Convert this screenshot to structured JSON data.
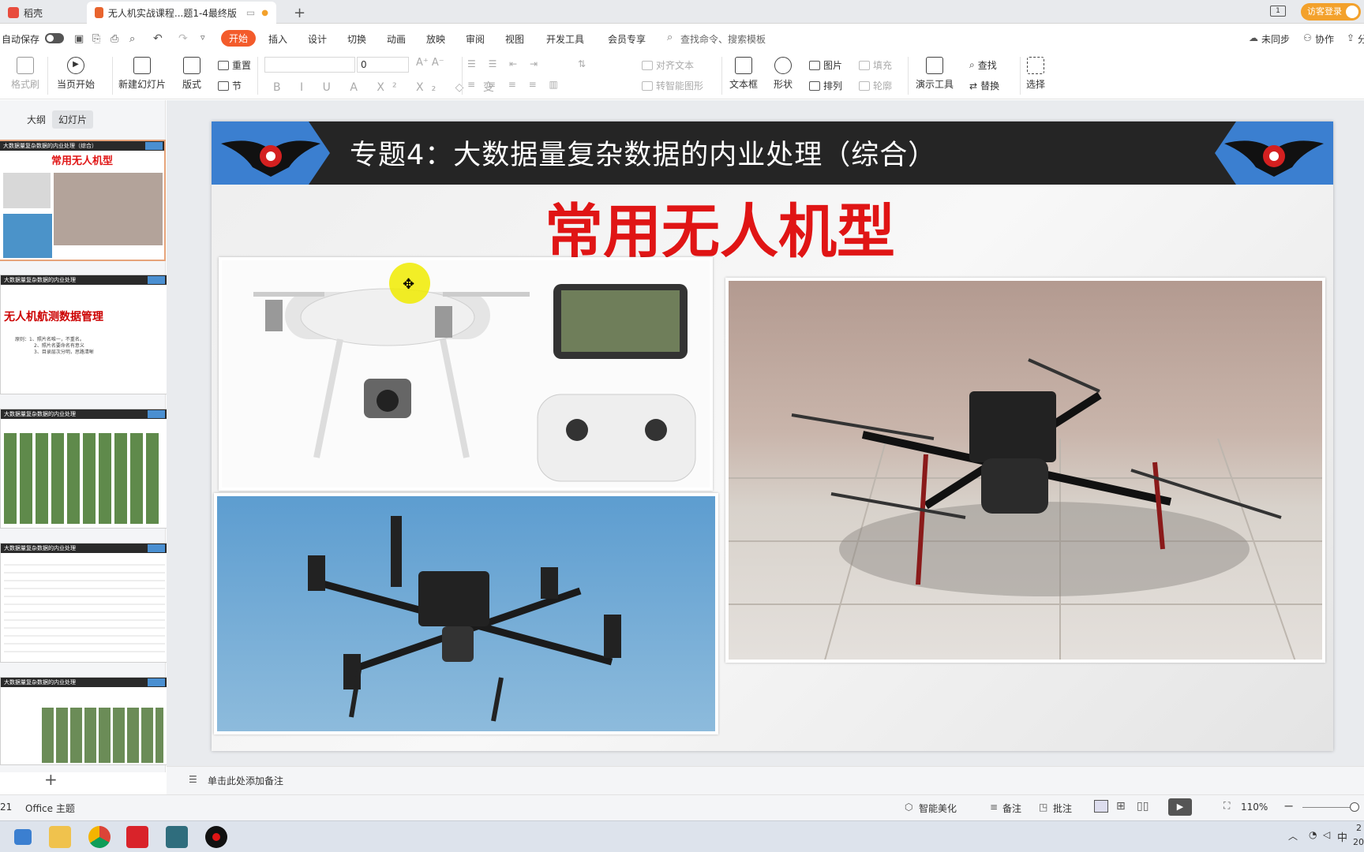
{
  "tabs": [
    {
      "label": "稻壳"
    },
    {
      "label": "无人机实战课程...题1-4最终版"
    }
  ],
  "titlebar": {
    "guest_login": "访客登录"
  },
  "menu": {
    "autosave": "自动保存",
    "items": [
      "开始",
      "插入",
      "设计",
      "切换",
      "动画",
      "放映",
      "审阅",
      "视图",
      "开发工具",
      "会员专享"
    ],
    "search": "查找命令、搜索模板",
    "unsync": "未同步",
    "collab": "协作",
    "share": "分"
  },
  "ribbon": {
    "format_painter": "格式刷",
    "from_current": "当页开始",
    "new_slide": "新建幻灯片",
    "layout": "版式",
    "reset": "重置",
    "section": "节",
    "font_size": "0",
    "align_text": "对齐文本",
    "to_smartart": "转智能图形",
    "textbox": "文本框",
    "shape": "形状",
    "picture": "图片",
    "arrange": "排列",
    "fill": "填充",
    "outline": "轮廓",
    "presenter": "演示工具",
    "find": "查找",
    "replace": "替换",
    "select": "选择"
  },
  "panel": {
    "outline_tab": "大纲",
    "slides_tab": "幻灯片",
    "add_label": "+"
  },
  "thumbs": [
    {
      "header": "大数据量复杂数据的内业处理（综合）",
      "title": "常用无人机型"
    },
    {
      "header": "大数据量复杂数据的内业处理",
      "title": "无人机航测数据管理",
      "body": [
        "原则：1、照片名唯一，不重名。",
        "2、照片名要命名有意义",
        "3、目录层次分明，思路清晰"
      ]
    },
    {
      "header": "大数据量复杂数据的内业处理",
      "title": ""
    },
    {
      "header": "大数据量复杂数据的内业处理",
      "title": ""
    },
    {
      "header": "大数据量复杂数据的内业处理",
      "title": ""
    }
  ],
  "slide": {
    "header_title": "专题4：大数据量复杂数据的内业处理（综合）",
    "main_title": "常用无人机型"
  },
  "notes": {
    "placeholder": "单击此处添加备注"
  },
  "status": {
    "page_num": "21",
    "theme": "Office 主题",
    "beautify": "智能美化",
    "notes": "备注",
    "comment": "批注",
    "zoom": "110%"
  },
  "taskbar": {
    "ime": "中",
    "clock_partial": "2",
    "date_partial": "202"
  },
  "colors": {
    "accent": "#f35b2b",
    "slide_red": "#e01515",
    "slide_header": "#252525",
    "wing_blue": "#3b7fd0"
  }
}
